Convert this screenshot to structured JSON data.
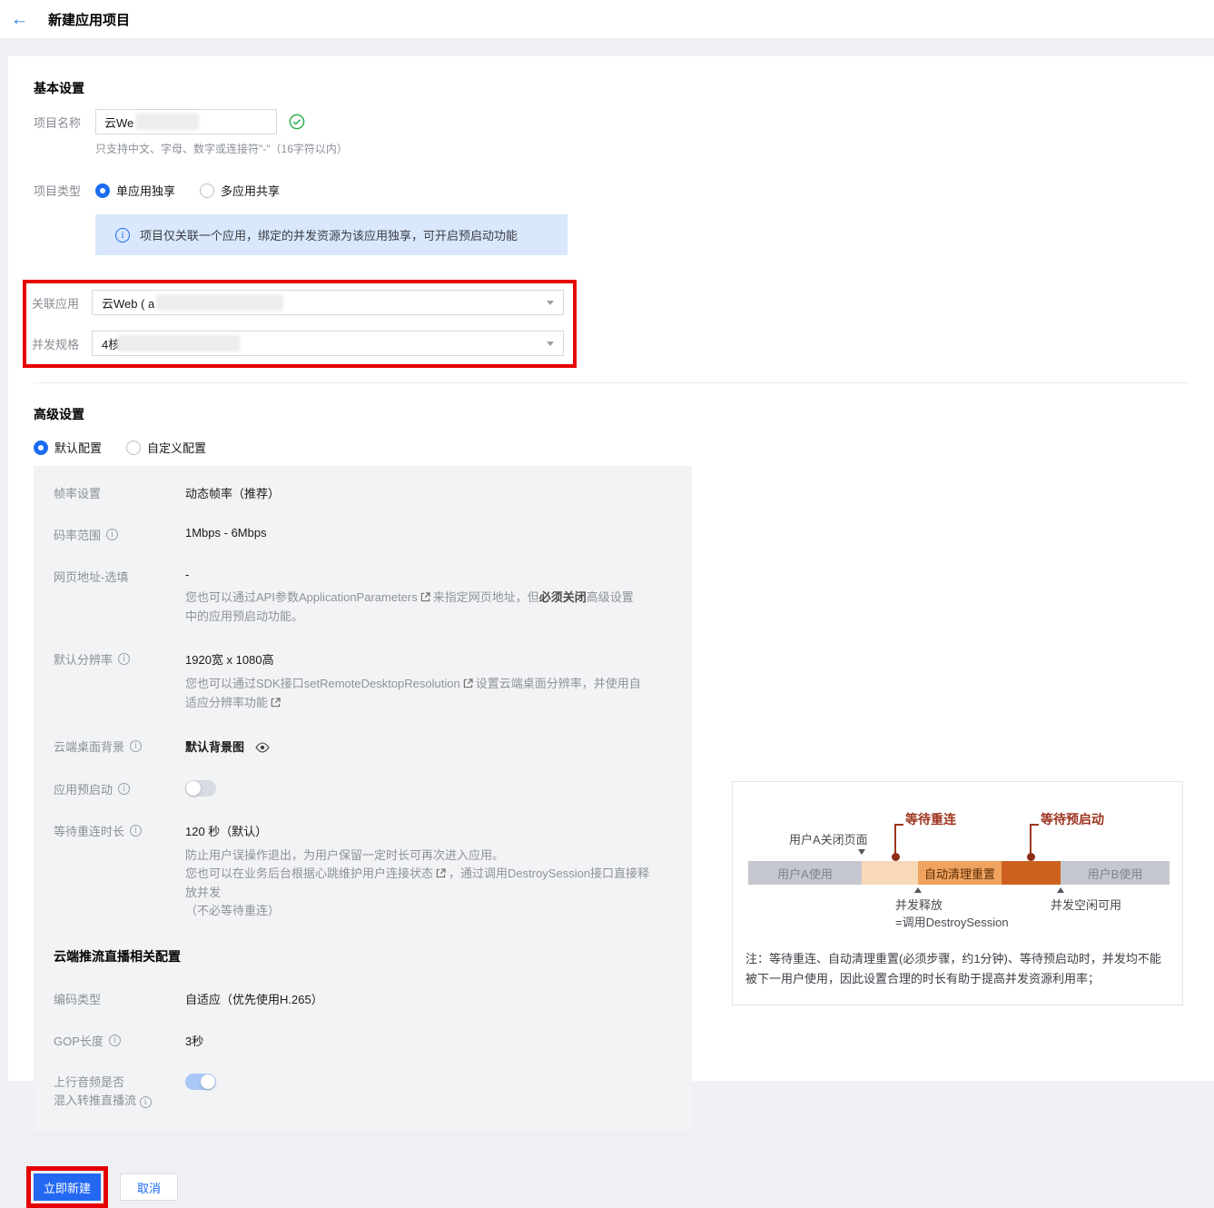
{
  "colors": {
    "accent": "#1c6cf2",
    "annotation_red": "#e60000",
    "banner_bg": "#d9e8fc",
    "panel_bg": "#f2f3f5",
    "success_green": "#2fae4e",
    "bar_gray": "#c4c8ce",
    "bar_light_orange": "#f7d9b9",
    "bar_mid_orange": "#f0a25f",
    "bar_dark_orange": "#cd6120",
    "diagram_red_label": "#9e3420"
  },
  "icons": {
    "back_glyph": "←",
    "info_glyph": "i"
  },
  "header": {
    "title": "新建应用项目"
  },
  "basic": {
    "section_title": "基本设置",
    "name_label": "项目名称",
    "name_value": "云We",
    "name_hint": "只支持中文、字母、数字或连接符\"-\"（16字符以内）",
    "type_label": "项目类型",
    "type_option_1": "单应用独享",
    "type_option_2": "多应用共享",
    "banner_text": "项目仅关联一个应用，绑定的并发资源为该应用独享，可开启预启动功能",
    "app_label": "关联应用",
    "app_value": "云Web ( a",
    "spec_label": "并发规格",
    "spec_value": "4核"
  },
  "advanced": {
    "section_title": "高级设置",
    "config_option_1": "默认配置",
    "config_option_2": "自定义配置",
    "fps_label": "帧率设置",
    "fps_value": "动态帧率（推荐）",
    "bitrate_label": "码率范围",
    "bitrate_value": "1Mbps - 6Mbps",
    "weburl_label": "网页地址-选填",
    "weburl_value": "-",
    "weburl_desc_1": "您也可以通过API参数ApplicationParameters",
    "weburl_desc_2": "来指定网页地址，但",
    "weburl_desc_bold": "必须关闭",
    "weburl_desc_3": "高级设置中的应用预启动功能。",
    "res_label": "默认分辨率",
    "res_value": "1920宽 x 1080高",
    "res_desc_1": "您也可以通过SDK接口setRemoteDesktopResolution",
    "res_desc_2": "设置云端桌面分辨率，并使用自适应分辨率功能",
    "bg_label": "云端桌面背景",
    "bg_value": "默认背景图",
    "preheat_label": "应用预启动",
    "preheat_enabled": false,
    "reconnect_label": "等待重连时长",
    "reconnect_value": "120 秒（默认）",
    "reconnect_desc_1": "防止用户误操作退出，为用户保留一定时长可再次进入应用。",
    "reconnect_desc_2a": "您也可以在业务后台根据心跳维护用户连接状态",
    "reconnect_desc_2b": "，通过调用DestroySession接口直接释放并发",
    "reconnect_desc_3": "（不必等待重连）"
  },
  "push": {
    "section_title": "云端推流直播相关配置",
    "codec_label": "编码类型",
    "codec_value": "自适应（优先使用H.265）",
    "gop_label": "GOP长度",
    "gop_value": "3秒",
    "audio_label_1": "上行音频是否",
    "audio_label_2": "混入转推直播流",
    "audio_mix_enabled": true
  },
  "diagram": {
    "user_a_close": "用户A关闭页面",
    "wait_reconnect": "等待重连",
    "wait_preheat": "等待预启动",
    "seg_user_a": "用户A使用",
    "seg_auto_reset": "自动清理重置",
    "seg_user_b": "用户B使用",
    "release_line1": "并发释放",
    "release_line2": "=调用DestroySession",
    "idle_label": "并发空闲可用",
    "note_line1": "注：等待重连、自动清理重置(必须步骤，约1分钟)、等待预启动时，并发均不能",
    "note_line2": "被下一用户使用，因此设置合理的时长有助于提高并发资源利用率；"
  },
  "footer": {
    "create_label": "立即新建",
    "cancel_label": "取消"
  }
}
